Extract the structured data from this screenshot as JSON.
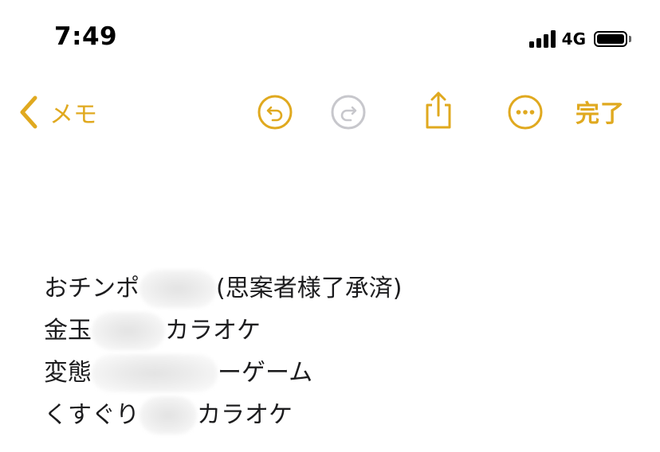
{
  "status_bar": {
    "time": "7:49",
    "network": "4G",
    "icons": [
      "signal-bars-icon",
      "battery-icon"
    ]
  },
  "toolbar": {
    "back_label": "メモ",
    "done_label": "完了",
    "icons": [
      "chevron-left-icon",
      "undo-icon",
      "redo-icon",
      "share-icon",
      "more-icon"
    ],
    "accent_color": "#e0a91f",
    "disabled_color": "#c7c7cc"
  },
  "note": {
    "lines": [
      {
        "before": "おチンポ",
        "after": "(思案者様了承済)"
      },
      {
        "before": "金玉",
        "after": "カラオケ"
      },
      {
        "before": "変態",
        "after": "ーゲーム"
      },
      {
        "before": "くすぐり",
        "after": "カラオケ"
      }
    ],
    "redaction_note": "portions blurred"
  }
}
